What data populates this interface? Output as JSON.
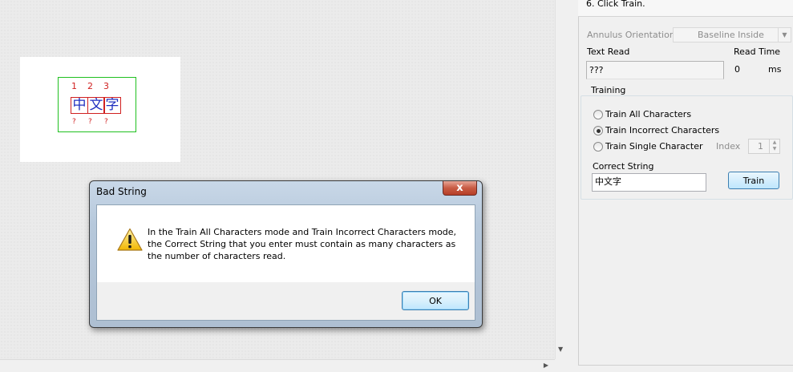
{
  "canvas": {
    "roi_numbers": [
      "1",
      "2",
      "3"
    ],
    "roi_chars": [
      "中",
      "文",
      "字"
    ],
    "roi_unknown": [
      "?",
      "?",
      "?"
    ]
  },
  "panel": {
    "step_text": "6. Click Train.",
    "annulus_orientation_label": "Annulus Orientation",
    "annulus_orientation_value": "Baseline Inside",
    "text_read_label": "Text Read",
    "text_read_value": "???",
    "read_time_label": "Read Time",
    "read_time_value": "0",
    "read_time_unit": "ms",
    "training_group_title": "Training",
    "radio_train_all": "Train All Characters",
    "radio_train_incorrect": "Train Incorrect Characters",
    "radio_train_single": "Train Single Character",
    "selected_mode": "Train Incorrect Characters",
    "index_label": "Index",
    "index_value": "1",
    "correct_string_label": "Correct String",
    "correct_string_value": "中文字",
    "train_button": "Train"
  },
  "dialog": {
    "title": "Bad String",
    "close_symbol": "x",
    "message_lines": [
      "In the Train All Characters mode and Train Incorrect Characters mode,",
      "the Correct String that you enter must contain as many characters as",
      "the number of characters read."
    ],
    "ok_button": "OK",
    "icon": "warning-icon"
  },
  "colors": {
    "roi_border": "#20c020",
    "char_box_border": "#d02020",
    "char_text": "#2030c0",
    "button_border": "#3c7fb1"
  }
}
